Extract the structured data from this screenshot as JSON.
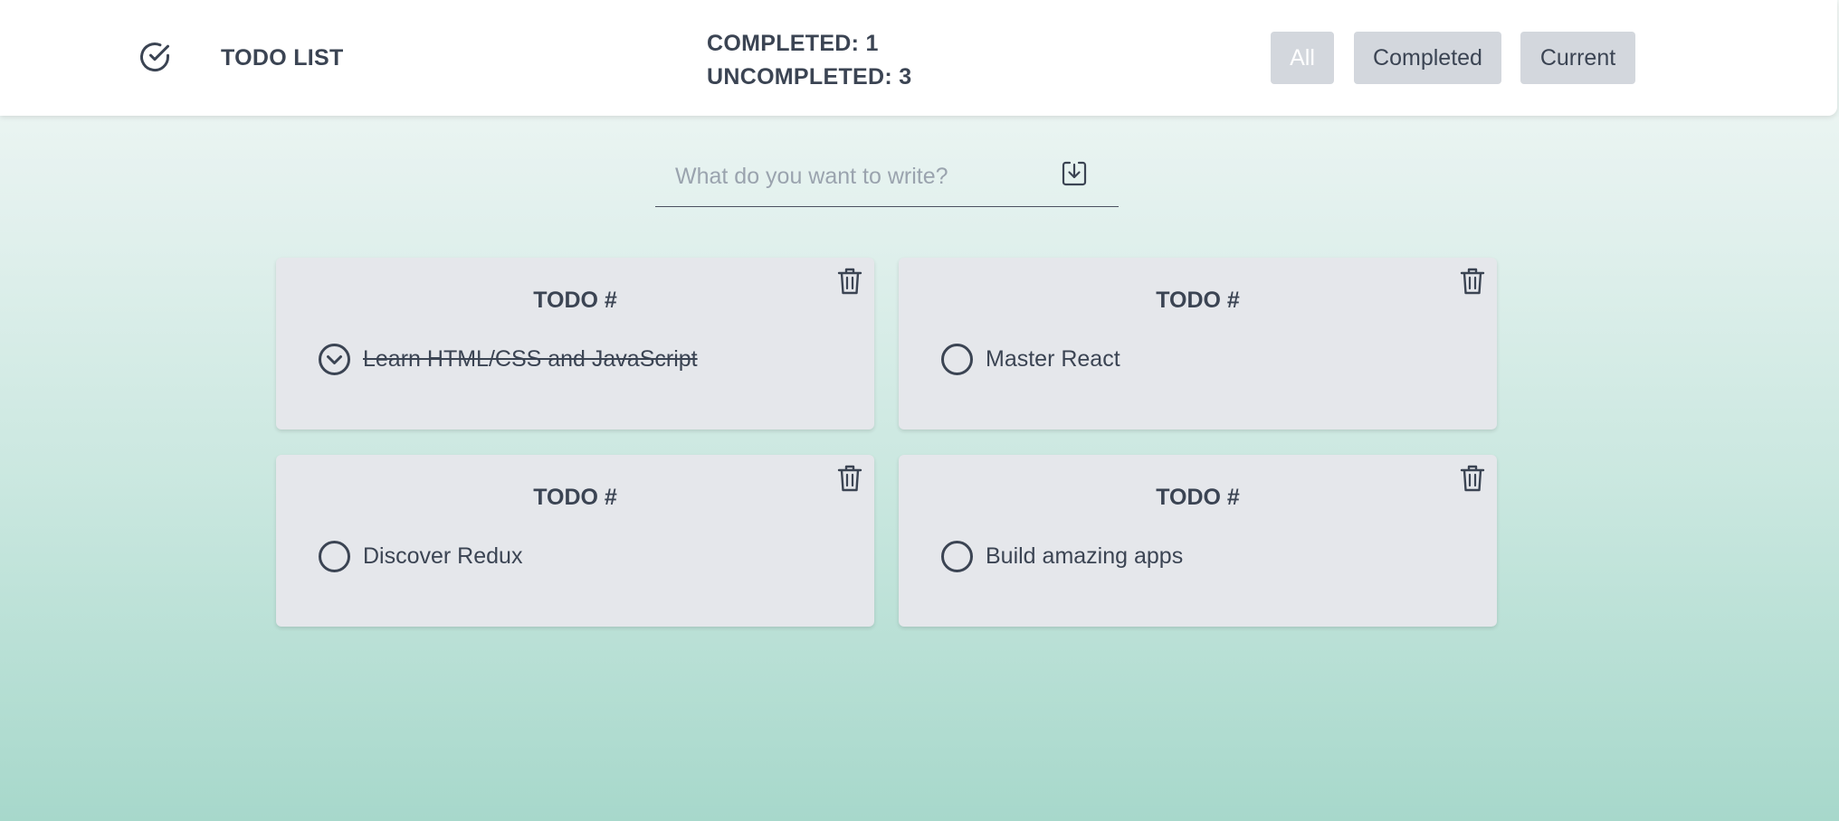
{
  "header": {
    "title": "TODO LIST",
    "logo_icon": "check-circle-icon",
    "stats": {
      "completed_label": "COMPLETED:",
      "completed_count": "1",
      "uncompleted_label": "UNCOMPLETED:",
      "uncompleted_count": "3"
    },
    "filters": {
      "all": "All",
      "completed": "Completed",
      "current": "Current",
      "active": "All"
    }
  },
  "input": {
    "placeholder": "What do you want to write?",
    "value": "",
    "submit_icon": "save-download-icon"
  },
  "todos": [
    {
      "title": "TODO #",
      "text": "Learn HTML/CSS and JavaScript",
      "completed": true
    },
    {
      "title": "TODO #",
      "text": "Master React",
      "completed": false
    },
    {
      "title": "TODO #",
      "text": "Discover Redux",
      "completed": false
    },
    {
      "title": "TODO #",
      "text": "Build amazing apps",
      "completed": false
    }
  ],
  "colors": {
    "text": "#3b4453",
    "card": "#e5e7eb",
    "button": "#d3d7dd",
    "gradient_top": "#f3f8f6",
    "gradient_bottom": "#a7d8cb"
  }
}
